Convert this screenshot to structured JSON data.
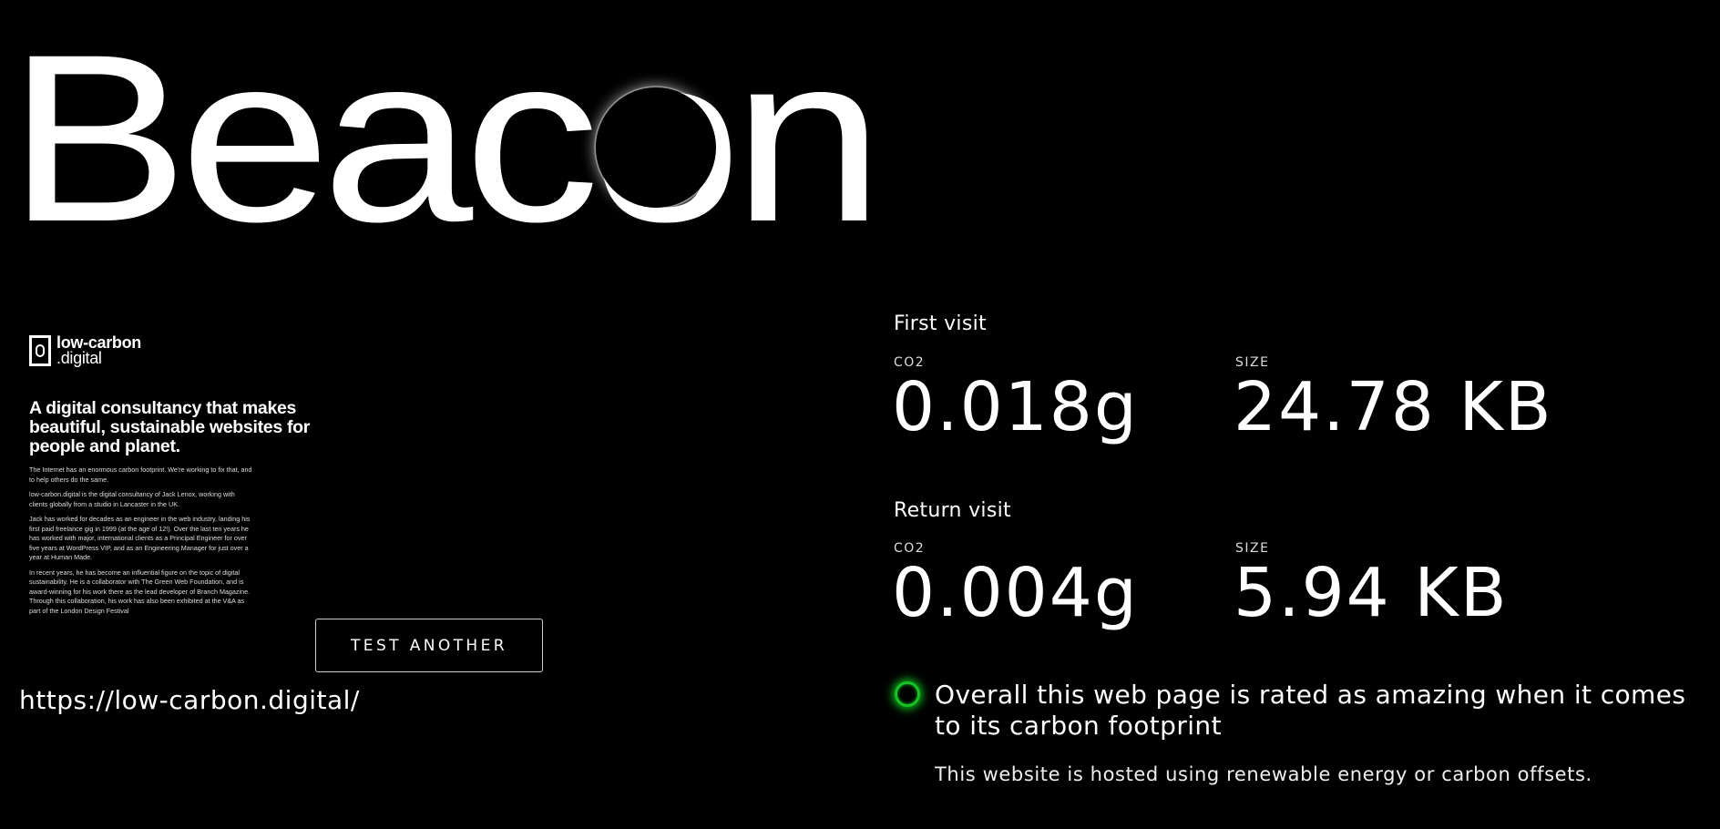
{
  "app": {
    "title": "Beacon"
  },
  "preview": {
    "brand": {
      "name": "low-carbon",
      "suffix": ".digital"
    },
    "headline": "A digital consultancy that makes beautiful, sustainable websites for people and planet.",
    "paragraphs": [
      "The Internet has an enormous carbon footprint. We're working to fix that, and to help others do the same.",
      "low-carbon.digital is the digital consultancy of Jack Lenox, working with clients globally from a studio in Lancaster in the UK.",
      "Jack has worked for decades as an engineer in the web industry, landing his first paid freelance gig in 1999 (at the age of 12!). Over the last ten years he has worked with major, international clients as a Principal Engineer for over five years at WordPress VIP, and as an Engineering Manager for just over a year at Human Made.",
      "In recent years, he has become an influential figure on the topic of digital sustainability. He is a collaborator with The Green Web Foundation, and is award-winning for his work there as the lead developer of Branch Magazine. Through this collaboration, his work has also been exhibited at the V&A as part of the London Design Festival"
    ]
  },
  "actions": {
    "test_another": "TEST ANOTHER"
  },
  "url": "https://low-carbon.digital/",
  "first_visit": {
    "heading": "First visit",
    "co2_label": "CO2",
    "co2_value": "0.018g",
    "size_label": "SIZE",
    "size_value": "24.78 KB"
  },
  "return_visit": {
    "heading": "Return visit",
    "co2_label": "CO2",
    "co2_value": "0.004g",
    "size_label": "SIZE",
    "size_value": "5.94 KB"
  },
  "rating": {
    "text": "Overall this web page is rated as amazing when it comes to its carbon footprint",
    "color": "#18c028"
  },
  "hosting": {
    "text": "This website is hosted using renewable energy or carbon offsets."
  }
}
